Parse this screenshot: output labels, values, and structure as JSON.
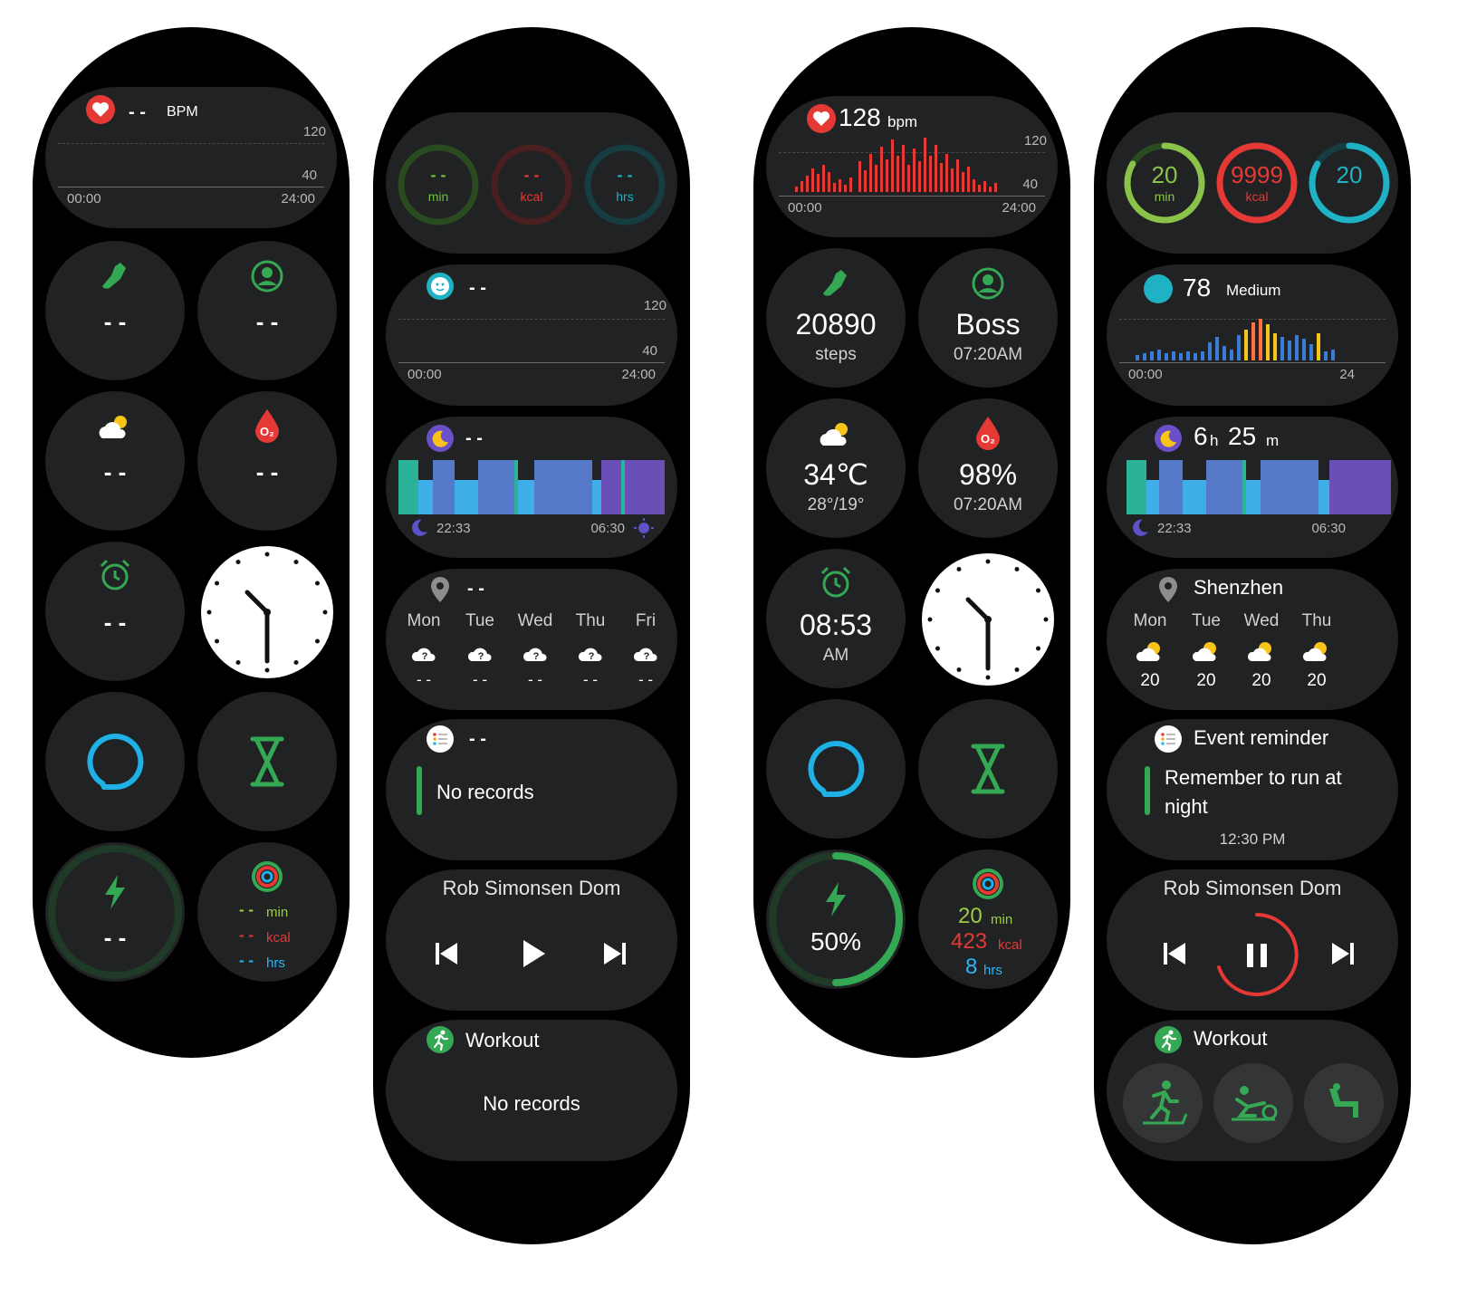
{
  "colors": {
    "bg": "#000000",
    "card": "#202224",
    "green": "#34a853",
    "red": "#e53935",
    "teal": "#1fb1c4",
    "cyan": "#29b6f6",
    "yellow": "#f9c41a"
  },
  "s1": {
    "hr": {
      "value": "- -",
      "unit": "BPM",
      "max": "120",
      "min": "40",
      "t_start": "00:00",
      "t_end": "24:00"
    },
    "steps": {
      "value": "- -"
    },
    "contact": {
      "value": "- -"
    },
    "weather": {
      "value": "- -"
    },
    "spo2": {
      "value": "- -"
    },
    "alarm": {
      "value": "- -"
    },
    "battery": {
      "value": "- -"
    },
    "activity": {
      "min_val": "- -",
      "min_unit": "min",
      "kcal_val": "- -",
      "kcal_unit": "kcal",
      "hrs_val": "- -",
      "hrs_unit": "hrs"
    }
  },
  "s2": {
    "rings": [
      {
        "value": "- -",
        "unit": "min"
      },
      {
        "value": "- -",
        "unit": "kcal"
      },
      {
        "value": "- -",
        "unit": "hrs"
      }
    ],
    "stress": {
      "value": "- -",
      "max": "120",
      "min": "40",
      "t_start": "00:00",
      "t_end": "24:00"
    },
    "sleep": {
      "value": "- -",
      "t_start": "22:33",
      "t_end": "06:30"
    },
    "weather": {
      "city": "- -",
      "days": [
        "Mon",
        "Tue",
        "Wed",
        "Thu",
        "Fri"
      ],
      "temps": [
        "- -",
        "- -",
        "- -",
        "- -",
        "- -"
      ]
    },
    "events": {
      "title": "- -",
      "text": "No records"
    },
    "music": {
      "track": "Rob Simonsen Dom"
    },
    "workout": {
      "title": "Workout",
      "text": "No records"
    }
  },
  "s3": {
    "hr": {
      "value": "128",
      "unit": "bpm",
      "max": "120",
      "min": "40",
      "t_start": "00:00",
      "t_end": "24:00"
    },
    "steps": {
      "value": "20890",
      "unit": "steps"
    },
    "contact": {
      "name": "Boss",
      "time": "07:20AM"
    },
    "weather": {
      "temp": "34℃",
      "range": "28°/19°"
    },
    "spo2": {
      "value": "98%",
      "time": "07:20AM"
    },
    "alarm": {
      "time": "08:53",
      "ampm": "AM"
    },
    "battery": {
      "value": "50%",
      "level": 0.5
    },
    "activity": {
      "min_val": "20",
      "min_unit": "min",
      "kcal_val": "423",
      "kcal_unit": "kcal",
      "hrs_val": "8",
      "hrs_unit": "hrs"
    }
  },
  "s4": {
    "rings": [
      {
        "value": "20",
        "unit": "min"
      },
      {
        "value": "9999",
        "unit": "kcal"
      },
      {
        "value": "20",
        "unit": ""
      }
    ],
    "stress": {
      "value": "78",
      "level": "Medium",
      "t_start": "00:00",
      "t_end": "24"
    },
    "sleep": {
      "hours": "6",
      "h_unit": "h",
      "minutes": "25",
      "m_unit": "m",
      "t_start": "22:33",
      "t_end": "06:30"
    },
    "weather": {
      "city": "Shenzhen",
      "days": [
        "Mon",
        "Tue",
        "Wed",
        "Thu"
      ],
      "temps": [
        "20",
        "20",
        "20",
        "20"
      ]
    },
    "events": {
      "title": "Event reminder",
      "text1": "Remember to run at",
      "text2": "night",
      "time": "12:30 PM"
    },
    "music": {
      "track": "Rob Simonsen Dom"
    },
    "workout": {
      "title": "Workout"
    }
  }
}
